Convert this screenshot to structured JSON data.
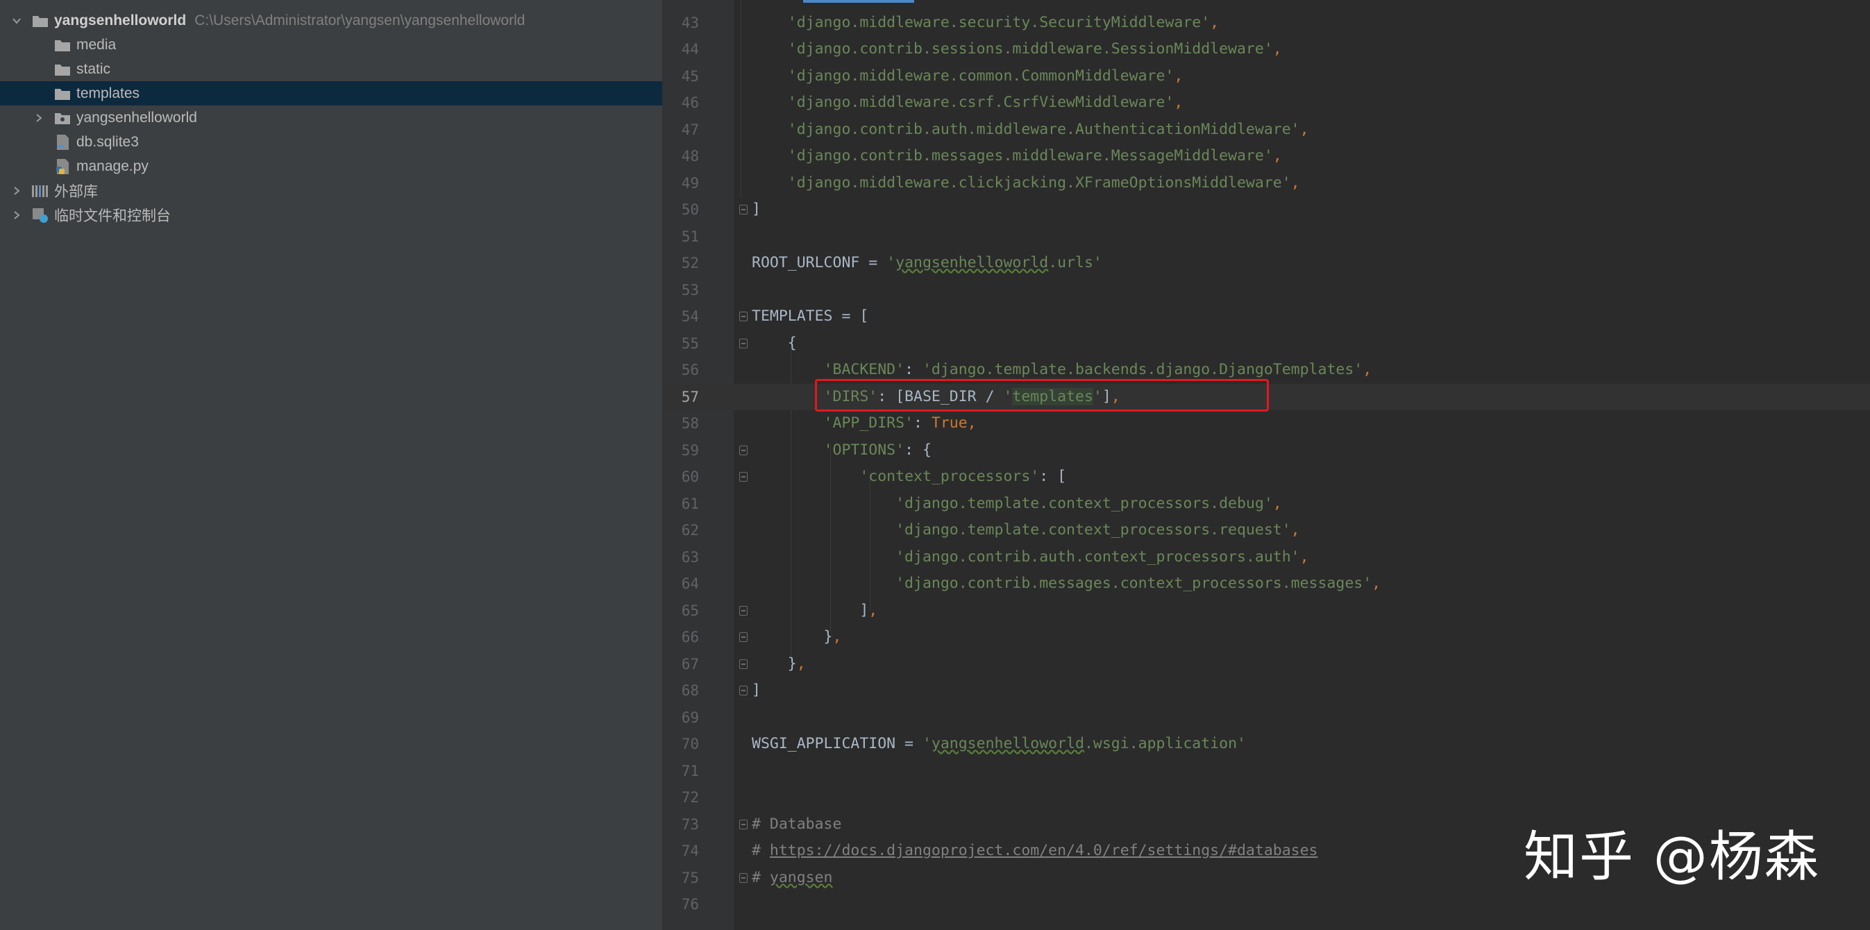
{
  "project_tree": {
    "root": {
      "name": "yangsenhelloworld",
      "path": "C:\\Users\\Administrator\\yangsen\\yangsenhelloworld"
    },
    "items": [
      {
        "label": "media"
      },
      {
        "label": "static"
      },
      {
        "label": "templates"
      },
      {
        "label": "yangsenhelloworld"
      },
      {
        "label": "db.sqlite3"
      },
      {
        "label": "manage.py"
      }
    ],
    "external_libraries": "外部库",
    "scratches": "临时文件和控制台"
  },
  "editor": {
    "current_line": 57,
    "lines": [
      {
        "n": "43",
        "code": "    'django.middleware.security.SecurityMiddleware',"
      },
      {
        "n": "44",
        "code": "    'django.contrib.sessions.middleware.SessionMiddleware',"
      },
      {
        "n": "45",
        "code": "    'django.middleware.common.CommonMiddleware',"
      },
      {
        "n": "46",
        "code": "    'django.middleware.csrf.CsrfViewMiddleware',"
      },
      {
        "n": "47",
        "code": "    'django.contrib.auth.middleware.AuthenticationMiddleware',"
      },
      {
        "n": "48",
        "code": "    'django.contrib.messages.middleware.MessageMiddleware',"
      },
      {
        "n": "49",
        "code": "    'django.middleware.clickjacking.XFrameOptionsMiddleware',"
      },
      {
        "n": "50",
        "code": "]"
      },
      {
        "n": "51",
        "code": ""
      },
      {
        "n": "52",
        "code": "ROOT_URLCONF = 'yangsenhelloworld.urls'"
      },
      {
        "n": "53",
        "code": ""
      },
      {
        "n": "54",
        "code": "TEMPLATES = ["
      },
      {
        "n": "55",
        "code": "    {"
      },
      {
        "n": "56",
        "code": "        'BACKEND': 'django.template.backends.django.DjangoTemplates',"
      },
      {
        "n": "57",
        "code": "        'DIRS': [BASE_DIR / 'templates'],"
      },
      {
        "n": "58",
        "code": "        'APP_DIRS': True,"
      },
      {
        "n": "59",
        "code": "        'OPTIONS': {"
      },
      {
        "n": "60",
        "code": "            'context_processors': ["
      },
      {
        "n": "61",
        "code": "                'django.template.context_processors.debug',"
      },
      {
        "n": "62",
        "code": "                'django.template.context_processors.request',"
      },
      {
        "n": "63",
        "code": "                'django.contrib.auth.context_processors.auth',"
      },
      {
        "n": "64",
        "code": "                'django.contrib.messages.context_processors.messages',"
      },
      {
        "n": "65",
        "code": "            ],"
      },
      {
        "n": "66",
        "code": "        },"
      },
      {
        "n": "67",
        "code": "    },"
      },
      {
        "n": "68",
        "code": "]"
      },
      {
        "n": "69",
        "code": ""
      },
      {
        "n": "70",
        "code": "WSGI_APPLICATION = 'yangsenhelloworld.wsgi.application'"
      },
      {
        "n": "71",
        "code": ""
      },
      {
        "n": "72",
        "code": ""
      },
      {
        "n": "73",
        "code": "# Database"
      },
      {
        "n": "74",
        "code": "# https://docs.djangoproject.com/en/4.0/ref/settings/#databases"
      },
      {
        "n": "75",
        "code": "# yangsen"
      },
      {
        "n": "76",
        "code": ""
      }
    ]
  },
  "watermark": "知乎 @杨森",
  "colors": {
    "string": "#6a8759",
    "keyword": "#cc7832",
    "comment": "#808080",
    "highlight": "#e0191e"
  }
}
